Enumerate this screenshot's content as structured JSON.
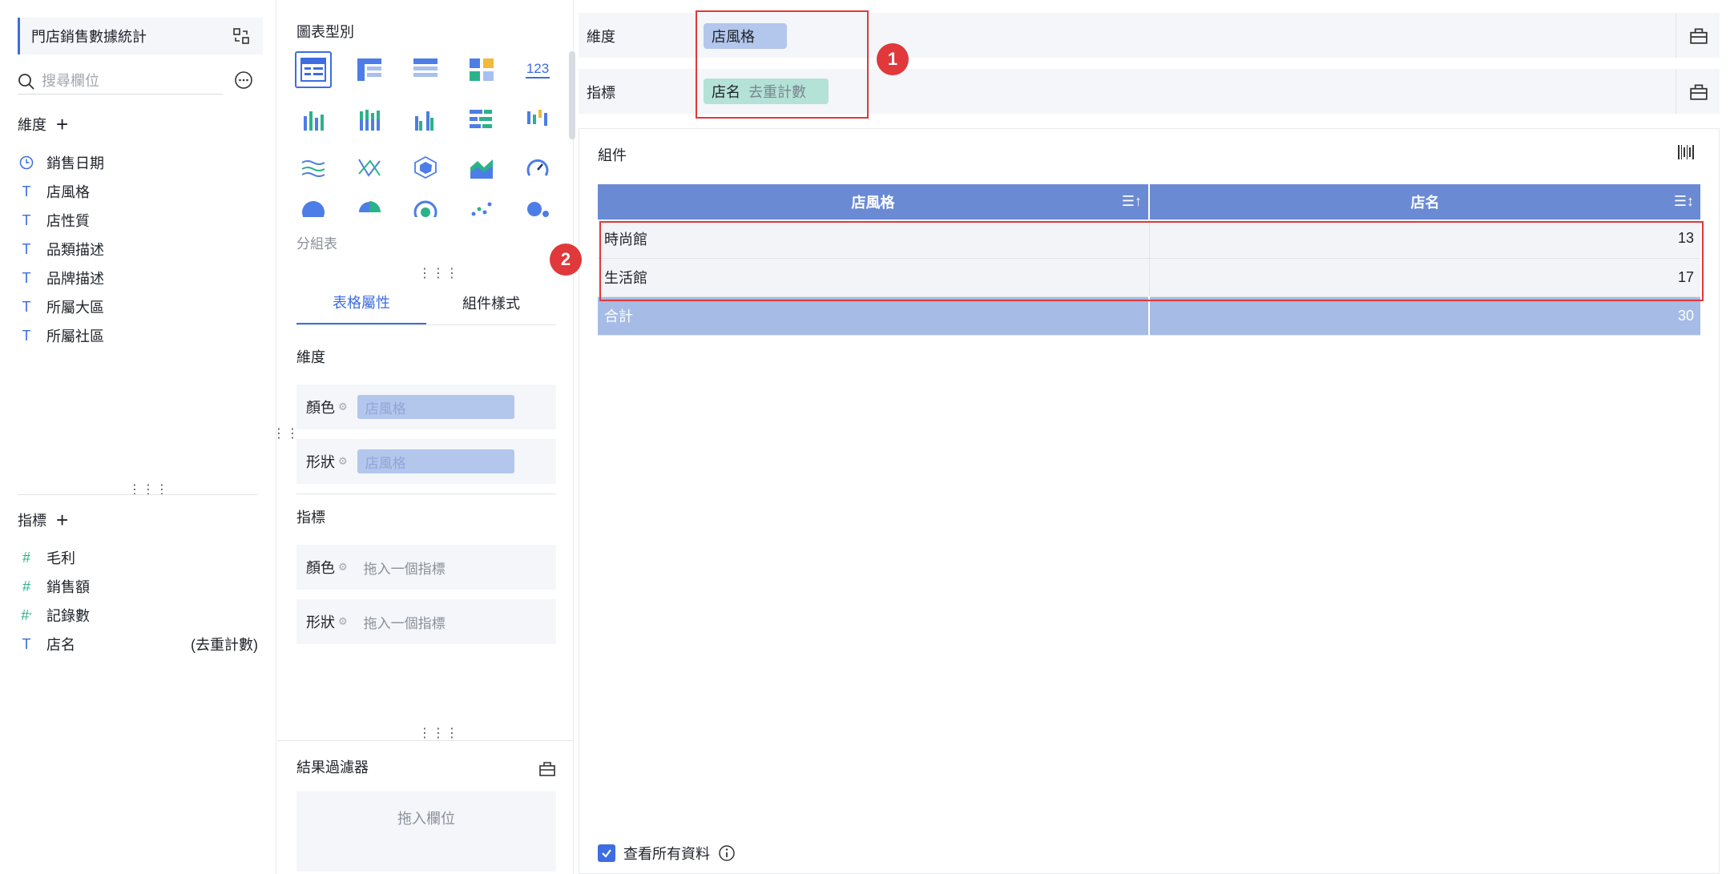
{
  "left_panel": {
    "dataset_title": "門店銷售數據統計",
    "search_placeholder": "搜尋欄位",
    "dimensions_label": "維度",
    "dimensions": [
      {
        "label": "銷售日期",
        "icon": "clock-icon"
      },
      {
        "label": "店風格",
        "icon": "text-type-icon"
      },
      {
        "label": "店性質",
        "icon": "text-type-icon"
      },
      {
        "label": "品類描述",
        "icon": "text-type-icon"
      },
      {
        "label": "品牌描述",
        "icon": "text-type-icon"
      },
      {
        "label": "所屬大區",
        "icon": "text-type-icon"
      },
      {
        "label": "所屬社區",
        "icon": "text-type-icon"
      }
    ],
    "metrics_label": "指標",
    "metrics": [
      {
        "label": "毛利",
        "icon": "hash-icon",
        "suffix": ""
      },
      {
        "label": "銷售額",
        "icon": "hash-icon",
        "suffix": ""
      },
      {
        "label": "記錄數",
        "icon": "hash-star-icon",
        "suffix": ""
      },
      {
        "label": "店名",
        "icon": "text-type-icon",
        "suffix": "(去重計數)"
      }
    ]
  },
  "mid_panel": {
    "chart_type_title": "圖表型別",
    "chart_type_selected_name": "分組表",
    "tabs": [
      "表格屬性",
      "組件樣式"
    ],
    "dimension_section": "維度",
    "metric_section": "指標",
    "dim_props": [
      {
        "label": "顏色",
        "value": "店風格"
      },
      {
        "label": "形狀",
        "value": "店風格"
      }
    ],
    "metric_props": [
      {
        "label": "顏色",
        "placeholder": "拖入一個指標"
      },
      {
        "label": "形狀",
        "placeholder": "拖入一個指標"
      }
    ],
    "filter_title": "結果過濾器",
    "filter_placeholder": "拖入欄位"
  },
  "right_panel": {
    "dimension_shelf_label": "維度",
    "metric_shelf_label": "指標",
    "dimension_pill": "店風格",
    "metric_pill": "店名",
    "metric_pill_agg": "去重計數",
    "badge_1": "1",
    "badge_2": "2",
    "component_title": "組件",
    "table": {
      "columns": [
        "店風格",
        "店名"
      ],
      "rows": [
        [
          "時尚館",
          "13"
        ],
        [
          "生活館",
          "17"
        ]
      ],
      "total": [
        "合計",
        "30"
      ]
    },
    "view_all_label": "查看所有資料"
  },
  "colors": {
    "accent": "#3d6de0",
    "header": "#6b8ad4",
    "dim_pill": "#b3c6ec",
    "metric_pill": "#b4e2d6",
    "highlight": "#e0383b"
  }
}
